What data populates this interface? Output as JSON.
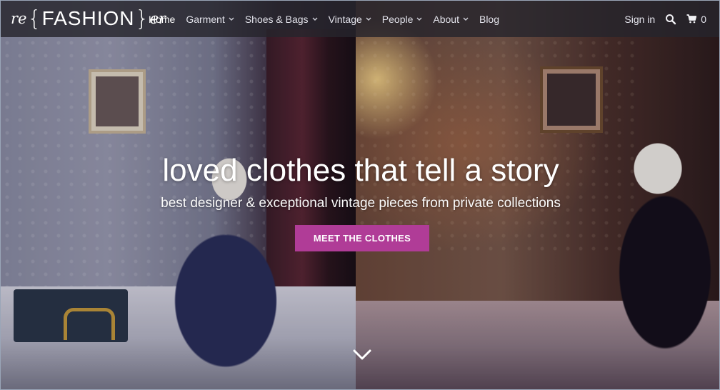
{
  "logo": {
    "prefix": "re",
    "open_brace": "{",
    "main": "FASHION",
    "close_brace": "}",
    "suffix": "er"
  },
  "nav": {
    "items": [
      {
        "label": "Home",
        "active": true,
        "dropdown": false
      },
      {
        "label": "Garment",
        "active": false,
        "dropdown": true
      },
      {
        "label": "Shoes & Bags",
        "active": false,
        "dropdown": true
      },
      {
        "label": "Vintage",
        "active": false,
        "dropdown": true
      },
      {
        "label": "People",
        "active": false,
        "dropdown": true
      },
      {
        "label": "About",
        "active": false,
        "dropdown": true
      },
      {
        "label": "Blog",
        "active": false,
        "dropdown": false
      }
    ],
    "caret": "⌄",
    "signin": "Sign in",
    "search_icon": "search-icon",
    "cart_icon": "cart-icon",
    "cart_count": "0"
  },
  "hero": {
    "headline": "loved clothes that tell a story",
    "subhead": "best designer & exceptional vintage pieces from private collections",
    "cta_label": "MEET THE CLOTHES",
    "scroll_icon": "chevron-down-icon"
  },
  "colors": {
    "accent": "#b03c97",
    "navbar": "#26242c"
  }
}
